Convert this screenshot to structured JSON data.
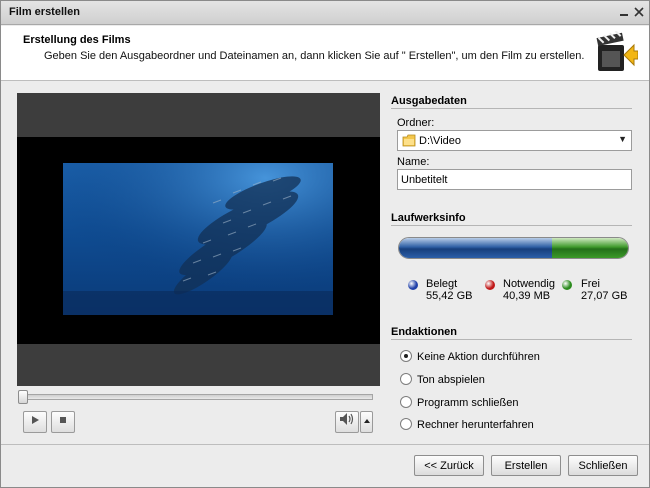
{
  "window": {
    "title": "Film erstellen"
  },
  "header": {
    "title": "Erstellung des Films",
    "description": "Geben Sie den Ausgabeordner und Dateinamen an, dann klicken Sie auf \" Erstellen\", um den Film zu erstellen."
  },
  "output": {
    "section_title": "Ausgabedaten",
    "folder_label": "Ordner:",
    "folder_value": "D:\\Video",
    "name_label": "Name:",
    "name_value": "Unbetitelt"
  },
  "drive": {
    "section_title": "Laufwerksinfo",
    "used_fraction": 0.67,
    "legend": [
      {
        "label": "Belegt",
        "value": "55,42 GB",
        "color": "#1f3fa8"
      },
      {
        "label": "Notwendig",
        "value": "40,39 MB",
        "color": "#c01818"
      },
      {
        "label": "Frei",
        "value": "27,07 GB",
        "color": "#2a8a1c"
      }
    ]
  },
  "end_actions": {
    "section_title": "Endaktionen",
    "options": [
      {
        "label": "Keine Aktion durchführen",
        "checked": true
      },
      {
        "label": "Ton abspielen",
        "checked": false
      },
      {
        "label": "Programm schließen",
        "checked": false
      },
      {
        "label": "Rechner herunterfahren",
        "checked": false
      }
    ]
  },
  "player": {
    "play_icon": "play-icon",
    "stop_icon": "stop-icon",
    "volume_icon": "speaker-icon",
    "position_fraction": 0.0
  },
  "footer": {
    "back_label": "<< Zurück",
    "create_label": "Erstellen",
    "close_label": "Schließen"
  }
}
